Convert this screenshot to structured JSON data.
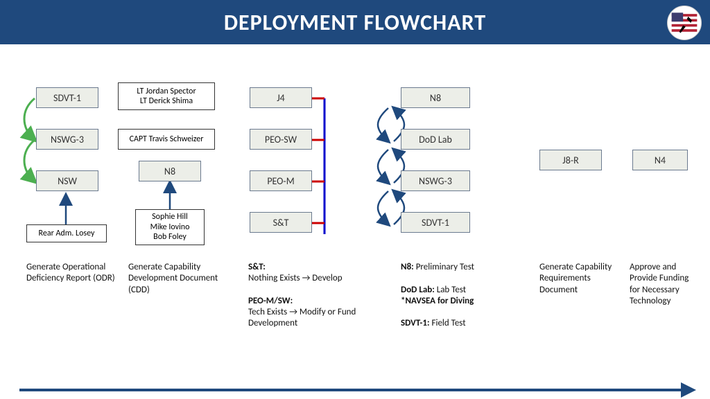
{
  "title": "DEPLOYMENT FLOWCHART",
  "col1": {
    "n1": "SDVT-1",
    "n2": "NSWG-3",
    "n3": "NSW",
    "note1": "LT Jordan Spector\nLT Derick Shima",
    "note2": "CAPT Travis Schweizer",
    "note3": "Rear Adm. Losey",
    "caption": "Generate Operational Deficiency Report (ODR)"
  },
  "col2": {
    "n1": "N8",
    "note1": "Sophie Hill\nMike Iovino\nBob Foley",
    "caption": "Generate Capability Development Document (CDD)"
  },
  "col3": {
    "n1": "J4",
    "n2": "PEO-SW",
    "n3": "PEO-M",
    "n4": "S&T",
    "cap1_label": "S&T:",
    "cap1_body": "Nothing Exists → Develop",
    "cap2_label": "PEO-M/SW:",
    "cap2_body": "Tech Exists → Modify or Fund Development"
  },
  "col4": {
    "n1": "N8",
    "n2": "DoD Lab",
    "n3": "NSWG-3",
    "n4": "SDVT-1",
    "cap1_label": "N8:",
    "cap1_body": " Preliminary Test",
    "cap2_label": "DoD Lab:",
    "cap2_body": " Lab Test",
    "cap3": "*NAVSEA for Diving",
    "cap4_label": "SDVT-1:",
    "cap4_body": " Field Test"
  },
  "col5": {
    "n1": "J8-R",
    "caption": "Generate Capability Requirements Document"
  },
  "col6": {
    "n1": "N4",
    "caption": "Approve and Provide Funding for Necessary Technology"
  }
}
